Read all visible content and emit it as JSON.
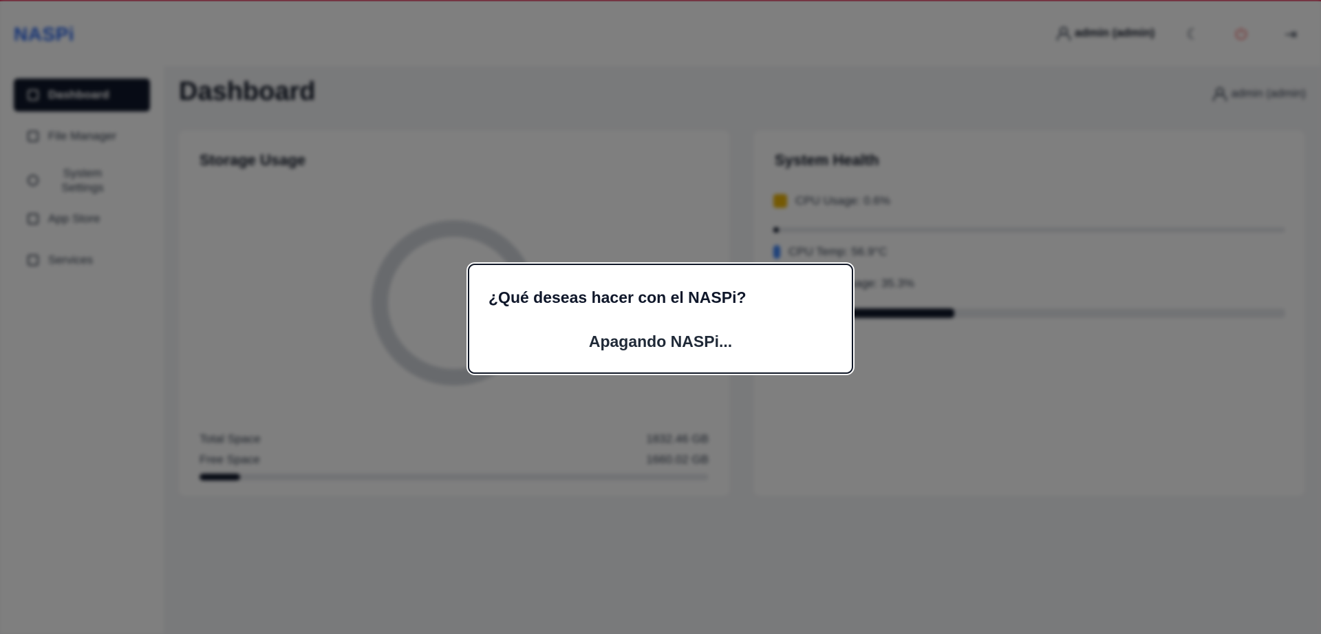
{
  "header": {
    "logo": "NASPi",
    "user_label": "admin (admin)",
    "theme_icon": "moon-icon",
    "power_icon": "power-icon",
    "logout_icon": "logout-icon"
  },
  "sidebar": {
    "items": [
      {
        "label": "Dashboard",
        "icon": "dashboard-icon",
        "active": true
      },
      {
        "label": "File Manager",
        "icon": "folder-icon",
        "active": false
      },
      {
        "label": "System Settings",
        "icon": "gear-icon",
        "active": false
      },
      {
        "label": "App Store",
        "icon": "store-icon",
        "active": false
      },
      {
        "label": "Services",
        "icon": "services-icon",
        "active": false
      }
    ]
  },
  "main": {
    "title": "Dashboard",
    "user_label": "admin (admin)",
    "storage": {
      "title": "Storage Usage",
      "total_label": "Total Space",
      "total_value": "1832.46 GB",
      "free_label": "Free Space",
      "free_value": "1660.02 GB",
      "used_fraction": 0.08
    },
    "health": {
      "title": "System Health",
      "cpu_usage": "CPU Usage: 0.6%",
      "cpu_fraction": 0.006,
      "cpu_temp": "CPU Temp: 56.9°C",
      "memory_usage": "Memory Usage: 35.3%",
      "memory_fraction": 0.353
    }
  },
  "modal": {
    "title": "¿Qué deseas hacer con el NASPi?",
    "status": "Apagando NASPi..."
  },
  "colors": {
    "accent": "#2563eb",
    "active_nav": "#0f172a",
    "power": "#ef4444",
    "top_accent": "#e11d48"
  }
}
